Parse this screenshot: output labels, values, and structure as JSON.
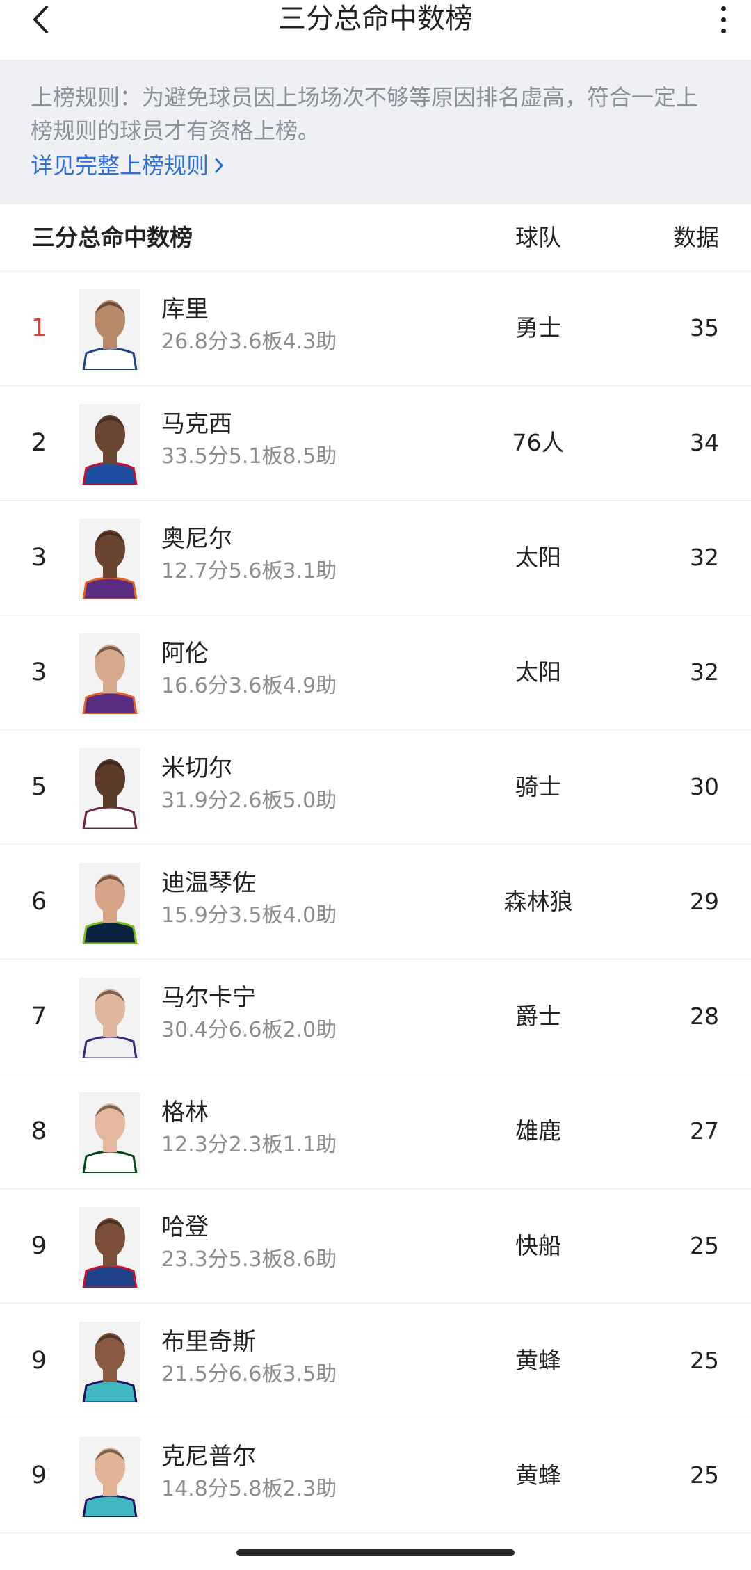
{
  "header": {
    "title": "三分总命中数榜"
  },
  "notice": {
    "text": "上榜规则：为避免球员因上场场次不够等原因排名虚高，符合一定上榜规则的球员才有资格上榜。",
    "link_label": "详见完整上榜规则"
  },
  "table": {
    "col_name": "三分总命中数榜",
    "col_team": "球队",
    "col_value": "数据"
  },
  "players": [
    {
      "rank": "1",
      "name": "库里",
      "stats": "26.8分3.6板4.3助",
      "team": "勇士",
      "value": "35",
      "skin": "#b98a6a",
      "jersey": "#ffffff",
      "trim": "#1d428a"
    },
    {
      "rank": "2",
      "name": "马克西",
      "stats": "33.5分5.1板8.5助",
      "team": "76人",
      "value": "34",
      "skin": "#6a4532",
      "jersey": "#1d4ea0",
      "trim": "#c8102e"
    },
    {
      "rank": "3",
      "name": "奥尼尔",
      "stats": "12.7分5.6板3.1助",
      "team": "太阳",
      "value": "32",
      "skin": "#6b4331",
      "jersey": "#5a2d82",
      "trim": "#e56020"
    },
    {
      "rank": "3",
      "name": "阿伦",
      "stats": "16.6分3.6板4.9助",
      "team": "太阳",
      "value": "32",
      "skin": "#d8a98a",
      "jersey": "#5a2d82",
      "trim": "#e56020"
    },
    {
      "rank": "5",
      "name": "米切尔",
      "stats": "31.9分2.6板5.0助",
      "team": "骑士",
      "value": "30",
      "skin": "#5c3a28",
      "jersey": "#ffffff",
      "trim": "#6f263d"
    },
    {
      "rank": "6",
      "name": "迪温琴佐",
      "stats": "15.9分3.5板4.0助",
      "team": "森林狼",
      "value": "29",
      "skin": "#d6a588",
      "jersey": "#0c2340",
      "trim": "#78be20"
    },
    {
      "rank": "7",
      "name": "马尔卡宁",
      "stats": "30.4分6.6板2.0助",
      "team": "爵士",
      "value": "28",
      "skin": "#e0b79c",
      "jersey": "#f2f2f5",
      "trim": "#3e2680"
    },
    {
      "rank": "8",
      "name": "格林",
      "stats": "12.3分2.3板1.1助",
      "team": "雄鹿",
      "value": "27",
      "skin": "#e4b89c",
      "jersey": "#ffffff",
      "trim": "#00471b"
    },
    {
      "rank": "9",
      "name": "哈登",
      "stats": "23.3分5.3板8.6助",
      "team": "快船",
      "value": "25",
      "skin": "#7a4e38",
      "jersey": "#1d428a",
      "trim": "#c8102e"
    },
    {
      "rank": "9",
      "name": "布里奇斯",
      "stats": "21.5分6.6板3.5助",
      "team": "黄蜂",
      "value": "25",
      "skin": "#8a5a40",
      "jersey": "#3fb8c0",
      "trim": "#1d1160"
    },
    {
      "rank": "9",
      "name": "克尼普尔",
      "stats": "14.8分5.8板2.3助",
      "team": "黄蜂",
      "value": "25",
      "skin": "#e2b394",
      "jersey": "#3fb8c0",
      "trim": "#1d1160"
    }
  ]
}
